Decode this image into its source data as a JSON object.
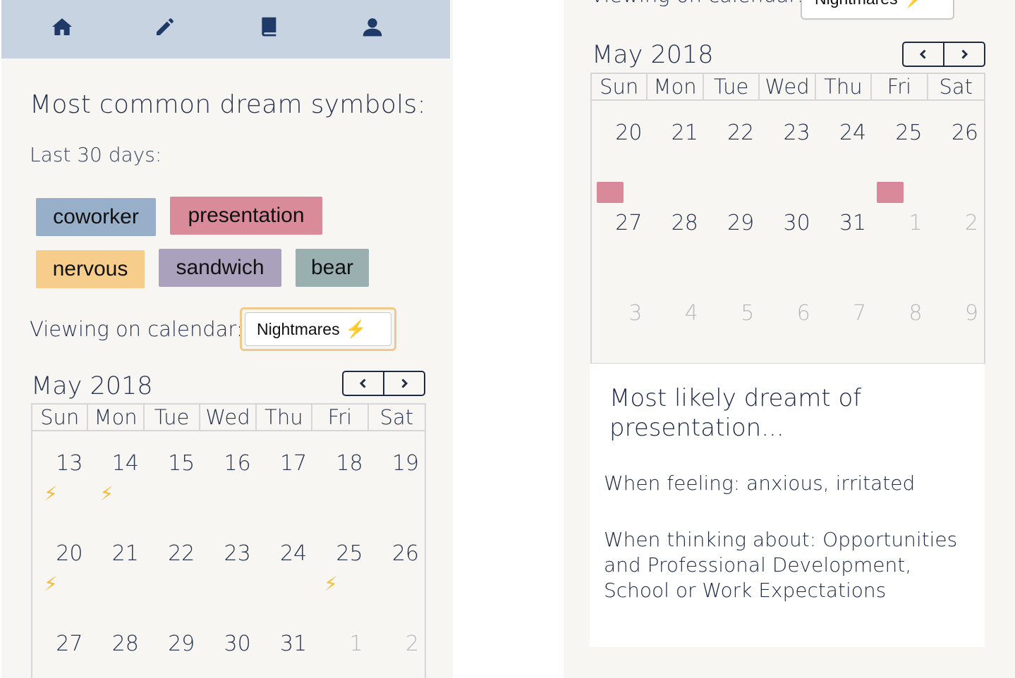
{
  "nav": {
    "items": [
      {
        "icon": "home-icon"
      },
      {
        "icon": "pencil-icon"
      },
      {
        "icon": "book-icon"
      },
      {
        "icon": "user-icon"
      }
    ]
  },
  "symbols": {
    "heading": "Most common dream symbols:",
    "period": "Last 30 days:",
    "tags": [
      {
        "label": "coworker",
        "color": "#97afc8"
      },
      {
        "label": "presentation",
        "color": "#d98b9a"
      },
      {
        "label": "nervous",
        "color": "#f7cd8c"
      },
      {
        "label": "sandwich",
        "color": "#aaa1bd"
      },
      {
        "label": "bear",
        "color": "#9ab0b0"
      }
    ]
  },
  "viewing": {
    "label": "Viewing on calendar:",
    "selected": "Nightmares",
    "selected_icon": "⚡"
  },
  "calendar_left": {
    "month": "May 2018",
    "weekdays": [
      "Sun",
      "Mon",
      "Tue",
      "Wed",
      "Thu",
      "Fri",
      "Sat"
    ],
    "weeks": [
      [
        "13",
        "14",
        "15",
        "16",
        "17",
        "18",
        "19"
      ],
      [
        "20",
        "21",
        "22",
        "23",
        "24",
        "25",
        "26"
      ],
      [
        "27",
        "28",
        "29",
        "30",
        "31",
        "1",
        "2"
      ]
    ],
    "nightmare_days": [
      "13",
      "14",
      "20",
      "25"
    ]
  },
  "calendar_right": {
    "month": "May 2018",
    "weekdays": [
      "Sun",
      "Mon",
      "Tue",
      "Wed",
      "Thu",
      "Fri",
      "Sat"
    ],
    "weeks": [
      [
        "20",
        "21",
        "22",
        "23",
        "24",
        "25",
        "26"
      ],
      [
        "27",
        "28",
        "29",
        "30",
        "31",
        "1",
        "2"
      ],
      [
        "3",
        "4",
        "5",
        "6",
        "7",
        "8",
        "9"
      ]
    ],
    "highlight_days": [
      "20",
      "25"
    ],
    "highlight_color": "#d8899a"
  },
  "detail": {
    "title": "Most likely dreamt of presentation...",
    "feeling": "When feeling: anxious, irritated",
    "thinking": "When thinking about: Opportunities and Professional Development, School or Work Expectations"
  }
}
